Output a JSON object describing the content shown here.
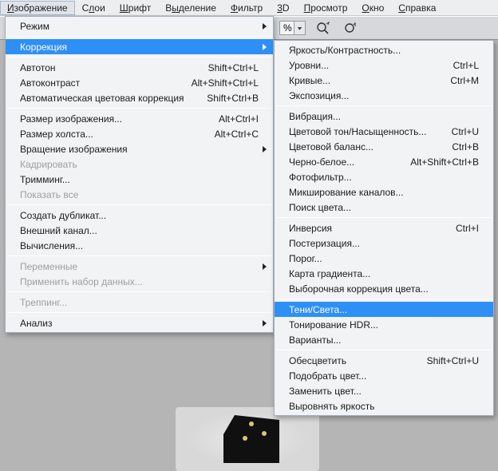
{
  "menubar": {
    "items": [
      {
        "label": "Изображение",
        "ul": 0
      },
      {
        "label": "Слои",
        "ul": 1
      },
      {
        "label": "Шрифт",
        "ul": 0
      },
      {
        "label": "Выделение",
        "ul": 1
      },
      {
        "label": "Фильтр",
        "ul": 0
      },
      {
        "label": "3D",
        "ul": 0
      },
      {
        "label": "Просмотр",
        "ul": 0
      },
      {
        "label": "Окно",
        "ul": 0
      },
      {
        "label": "Справка",
        "ul": 0
      }
    ]
  },
  "toolbar": {
    "pct": "%"
  },
  "menu1": [
    {
      "type": "item",
      "label": "Режим",
      "arrow": true
    },
    {
      "type": "sep"
    },
    {
      "type": "item",
      "label": "Коррекция",
      "arrow": true,
      "hl": true
    },
    {
      "type": "sep"
    },
    {
      "type": "item",
      "label": "Автотон",
      "shortcut": "Shift+Ctrl+L"
    },
    {
      "type": "item",
      "label": "Автоконтраст",
      "shortcut": "Alt+Shift+Ctrl+L"
    },
    {
      "type": "item",
      "label": "Автоматическая цветовая коррекция",
      "shortcut": "Shift+Ctrl+B"
    },
    {
      "type": "sep"
    },
    {
      "type": "item",
      "label": "Размер изображения...",
      "shortcut": "Alt+Ctrl+I"
    },
    {
      "type": "item",
      "label": "Размер холста...",
      "shortcut": "Alt+Ctrl+C"
    },
    {
      "type": "item",
      "label": "Вращение изображения",
      "arrow": true
    },
    {
      "type": "item",
      "label": "Кадрировать",
      "disabled": true
    },
    {
      "type": "item",
      "label": "Тримминг..."
    },
    {
      "type": "item",
      "label": "Показать все",
      "disabled": true
    },
    {
      "type": "sep"
    },
    {
      "type": "item",
      "label": "Создать дубликат..."
    },
    {
      "type": "item",
      "label": "Внешний канал..."
    },
    {
      "type": "item",
      "label": "Вычисления..."
    },
    {
      "type": "sep"
    },
    {
      "type": "item",
      "label": "Переменные",
      "arrow": true,
      "disabled": true
    },
    {
      "type": "item",
      "label": "Применить набор данных...",
      "disabled": true
    },
    {
      "type": "sep"
    },
    {
      "type": "item",
      "label": "Треппинг...",
      "disabled": true
    },
    {
      "type": "sep"
    },
    {
      "type": "item",
      "label": "Анализ",
      "arrow": true
    }
  ],
  "menu2": [
    {
      "type": "item",
      "label": "Яркость/Контрастность..."
    },
    {
      "type": "item",
      "label": "Уровни...",
      "shortcut": "Ctrl+L"
    },
    {
      "type": "item",
      "label": "Кривые...",
      "shortcut": "Ctrl+M"
    },
    {
      "type": "item",
      "label": "Экспозиция..."
    },
    {
      "type": "sep"
    },
    {
      "type": "item",
      "label": "Вибрация..."
    },
    {
      "type": "item",
      "label": "Цветовой тон/Насыщенность...",
      "shortcut": "Ctrl+U"
    },
    {
      "type": "item",
      "label": "Цветовой баланс...",
      "shortcut": "Ctrl+B"
    },
    {
      "type": "item",
      "label": "Черно-белое...",
      "shortcut": "Alt+Shift+Ctrl+B"
    },
    {
      "type": "item",
      "label": "Фотофильтр..."
    },
    {
      "type": "item",
      "label": "Микширование каналов..."
    },
    {
      "type": "item",
      "label": "Поиск цвета..."
    },
    {
      "type": "sep"
    },
    {
      "type": "item",
      "label": "Инверсия",
      "shortcut": "Ctrl+I"
    },
    {
      "type": "item",
      "label": "Постеризация..."
    },
    {
      "type": "item",
      "label": "Порог..."
    },
    {
      "type": "item",
      "label": "Карта градиента..."
    },
    {
      "type": "item",
      "label": "Выборочная коррекция цвета..."
    },
    {
      "type": "sep"
    },
    {
      "type": "item",
      "label": "Тени/Света...",
      "hl": true
    },
    {
      "type": "item",
      "label": "Тонирование HDR..."
    },
    {
      "type": "item",
      "label": "Варианты..."
    },
    {
      "type": "sep"
    },
    {
      "type": "item",
      "label": "Обесцветить",
      "shortcut": "Shift+Ctrl+U"
    },
    {
      "type": "item",
      "label": "Подобрать цвет..."
    },
    {
      "type": "item",
      "label": "Заменить цвет..."
    },
    {
      "type": "item",
      "label": "Выровнять яркость"
    }
  ]
}
